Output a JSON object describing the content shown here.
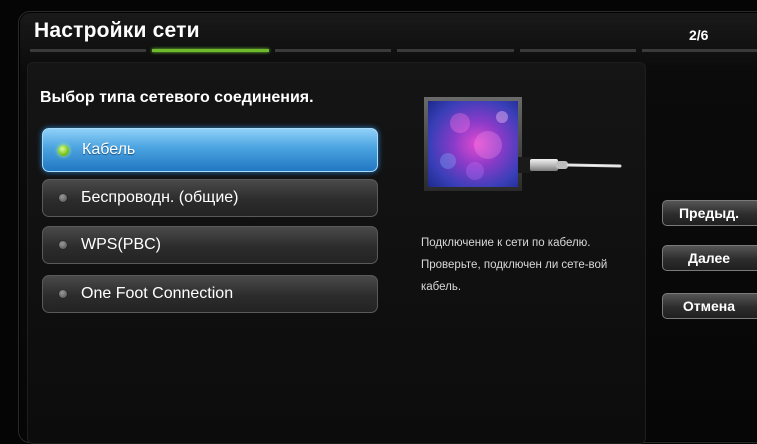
{
  "header": {
    "title": "Настройки сети",
    "page_counter": "2/6"
  },
  "progress": {
    "total_steps": 6,
    "current_step": 2
  },
  "main": {
    "subtitle": "Выбор типа сетевого соединения.",
    "options": [
      {
        "label": "Кабель",
        "selected": true
      },
      {
        "label": "Беспроводн. (общие)",
        "selected": false
      },
      {
        "label": "WPS(PBC)",
        "selected": false
      },
      {
        "label": "One Foot Connection",
        "selected": false
      }
    ],
    "description": "Подключение к сети по кабелю. Проверьте, подключен ли сете-вой кабель."
  },
  "buttons": {
    "previous": "Предыд.",
    "next": "Далее",
    "cancel": "Отмена"
  },
  "colors": {
    "accent_selected": "#4aa3e0",
    "progress_active": "#6dbb2c",
    "indicator_active": "#7cc41e"
  },
  "icons": {
    "illustration": "tv-with-ethernet-cable-icon"
  }
}
